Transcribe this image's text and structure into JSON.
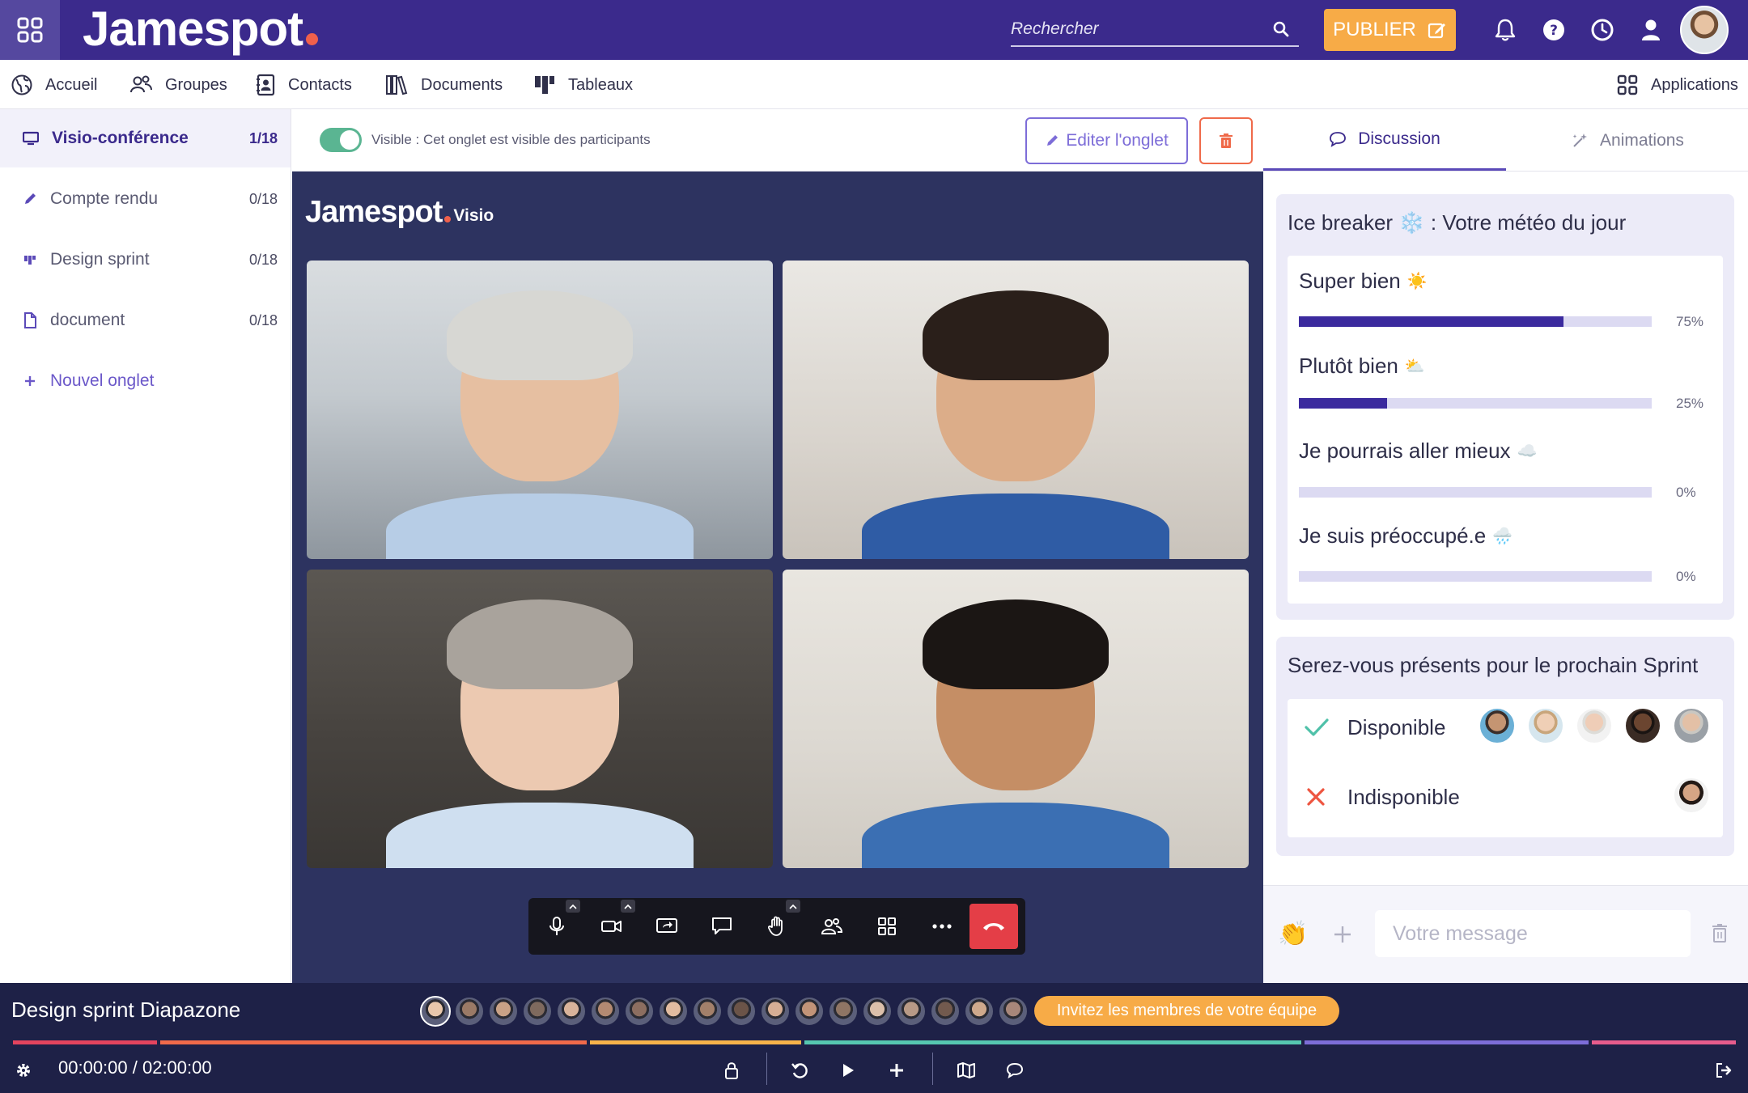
{
  "header": {
    "logo": "Jamespot",
    "search_placeholder": "Rechercher",
    "publish_label": "PUBLIER"
  },
  "nav": {
    "items": [
      {
        "label": "Accueil",
        "icon": "globe-icon"
      },
      {
        "label": "Groupes",
        "icon": "people-icon"
      },
      {
        "label": "Contacts",
        "icon": "contacts-book-icon"
      },
      {
        "label": "Documents",
        "icon": "books-icon"
      },
      {
        "label": "Tableaux",
        "icon": "board-icon"
      }
    ],
    "applications_label": "Applications"
  },
  "sidebar": {
    "tabs": [
      {
        "label": "Visio-conférence",
        "count": "1/18",
        "icon": "monitor-icon",
        "active": true
      },
      {
        "label": "Compte  rendu",
        "count": "0/18",
        "icon": "pencil-icon"
      },
      {
        "label": "Design sprint",
        "count": "0/18",
        "icon": "board-icon"
      },
      {
        "label": "document",
        "count": "0/18",
        "icon": "file-icon"
      }
    ],
    "new_tab_label": "Nouvel onglet"
  },
  "tab_header": {
    "visible_text": "Visible : Cet onglet est visible des participants",
    "visible_on": true,
    "edit_label": "Editer l'onglet"
  },
  "stage": {
    "logo_word": "Jamespot",
    "logo_sub": "Visio"
  },
  "right_panel": {
    "tabs": [
      {
        "label": "Discussion",
        "icon": "chat-bubble-icon",
        "active": true
      },
      {
        "label": "Animations",
        "icon": "magic-wand-icon"
      }
    ],
    "poll": {
      "title": "Ice breaker ❄️ : Votre météo du jour",
      "options": [
        {
          "label": "Super bien",
          "emoji": "☀️",
          "percent": 75,
          "percent_label": "75%"
        },
        {
          "label": "Plutôt bien",
          "emoji": "⛅",
          "percent": 25,
          "percent_label": "25%"
        },
        {
          "label": "Je pourrais aller mieux",
          "emoji": "☁️",
          "percent": 0,
          "percent_label": "0%"
        },
        {
          "label": "Je suis préoccupé.e",
          "emoji": "🌧️",
          "percent": 0,
          "percent_label": "0%"
        }
      ]
    },
    "attendance": {
      "title": "Serez-vous présents pour le prochain Sprint",
      "available_label": "Disponible",
      "unavailable_label": "Indisponible"
    },
    "composer": {
      "placeholder": "Votre message",
      "emoji": "👏"
    }
  },
  "session": {
    "title": "Design sprint Diapazone",
    "invite_label": "Invitez les membres de votre équipe",
    "timer": "00:00:00 / 02:00:00",
    "segments_colors": [
      "#e3445e",
      "#f06a4a",
      "#f7b34a",
      "#56c7b0",
      "#7d6dd8",
      "#e65c8c"
    ]
  },
  "colors": {
    "brand": "#3b2a8c",
    "accent_orange": "#f7ab47",
    "danger": "#e43e47",
    "toggle_green": "#5ab592"
  }
}
